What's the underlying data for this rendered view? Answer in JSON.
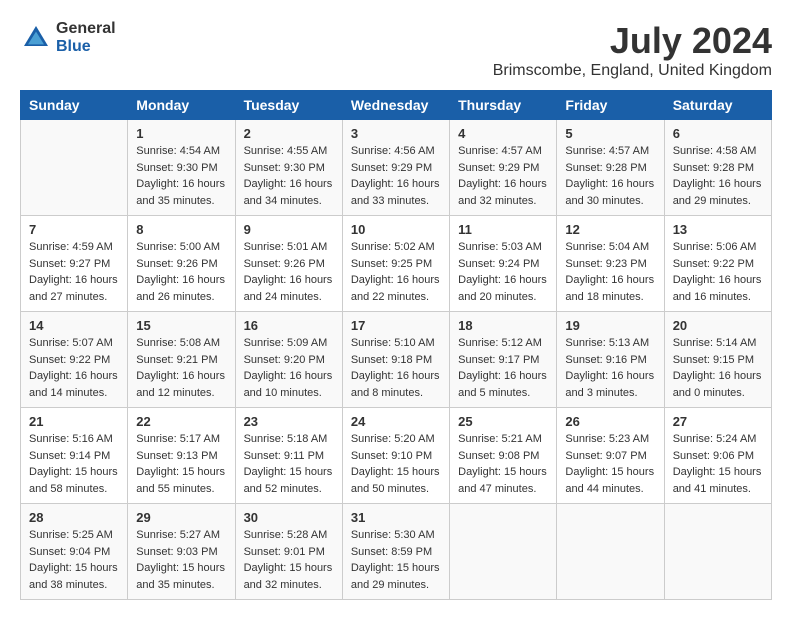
{
  "header": {
    "logo_general": "General",
    "logo_blue": "Blue",
    "title": "July 2024",
    "subtitle": "Brimscombe, England, United Kingdom"
  },
  "days_of_week": [
    "Sunday",
    "Monday",
    "Tuesday",
    "Wednesday",
    "Thursday",
    "Friday",
    "Saturday"
  ],
  "weeks": [
    [
      {
        "day": "",
        "info": ""
      },
      {
        "day": "1",
        "info": "Sunrise: 4:54 AM\nSunset: 9:30 PM\nDaylight: 16 hours\nand 35 minutes."
      },
      {
        "day": "2",
        "info": "Sunrise: 4:55 AM\nSunset: 9:30 PM\nDaylight: 16 hours\nand 34 minutes."
      },
      {
        "day": "3",
        "info": "Sunrise: 4:56 AM\nSunset: 9:29 PM\nDaylight: 16 hours\nand 33 minutes."
      },
      {
        "day": "4",
        "info": "Sunrise: 4:57 AM\nSunset: 9:29 PM\nDaylight: 16 hours\nand 32 minutes."
      },
      {
        "day": "5",
        "info": "Sunrise: 4:57 AM\nSunset: 9:28 PM\nDaylight: 16 hours\nand 30 minutes."
      },
      {
        "day": "6",
        "info": "Sunrise: 4:58 AM\nSunset: 9:28 PM\nDaylight: 16 hours\nand 29 minutes."
      }
    ],
    [
      {
        "day": "7",
        "info": "Sunrise: 4:59 AM\nSunset: 9:27 PM\nDaylight: 16 hours\nand 27 minutes."
      },
      {
        "day": "8",
        "info": "Sunrise: 5:00 AM\nSunset: 9:26 PM\nDaylight: 16 hours\nand 26 minutes."
      },
      {
        "day": "9",
        "info": "Sunrise: 5:01 AM\nSunset: 9:26 PM\nDaylight: 16 hours\nand 24 minutes."
      },
      {
        "day": "10",
        "info": "Sunrise: 5:02 AM\nSunset: 9:25 PM\nDaylight: 16 hours\nand 22 minutes."
      },
      {
        "day": "11",
        "info": "Sunrise: 5:03 AM\nSunset: 9:24 PM\nDaylight: 16 hours\nand 20 minutes."
      },
      {
        "day": "12",
        "info": "Sunrise: 5:04 AM\nSunset: 9:23 PM\nDaylight: 16 hours\nand 18 minutes."
      },
      {
        "day": "13",
        "info": "Sunrise: 5:06 AM\nSunset: 9:22 PM\nDaylight: 16 hours\nand 16 minutes."
      }
    ],
    [
      {
        "day": "14",
        "info": "Sunrise: 5:07 AM\nSunset: 9:22 PM\nDaylight: 16 hours\nand 14 minutes."
      },
      {
        "day": "15",
        "info": "Sunrise: 5:08 AM\nSunset: 9:21 PM\nDaylight: 16 hours\nand 12 minutes."
      },
      {
        "day": "16",
        "info": "Sunrise: 5:09 AM\nSunset: 9:20 PM\nDaylight: 16 hours\nand 10 minutes."
      },
      {
        "day": "17",
        "info": "Sunrise: 5:10 AM\nSunset: 9:18 PM\nDaylight: 16 hours\nand 8 minutes."
      },
      {
        "day": "18",
        "info": "Sunrise: 5:12 AM\nSunset: 9:17 PM\nDaylight: 16 hours\nand 5 minutes."
      },
      {
        "day": "19",
        "info": "Sunrise: 5:13 AM\nSunset: 9:16 PM\nDaylight: 16 hours\nand 3 minutes."
      },
      {
        "day": "20",
        "info": "Sunrise: 5:14 AM\nSunset: 9:15 PM\nDaylight: 16 hours\nand 0 minutes."
      }
    ],
    [
      {
        "day": "21",
        "info": "Sunrise: 5:16 AM\nSunset: 9:14 PM\nDaylight: 15 hours\nand 58 minutes."
      },
      {
        "day": "22",
        "info": "Sunrise: 5:17 AM\nSunset: 9:13 PM\nDaylight: 15 hours\nand 55 minutes."
      },
      {
        "day": "23",
        "info": "Sunrise: 5:18 AM\nSunset: 9:11 PM\nDaylight: 15 hours\nand 52 minutes."
      },
      {
        "day": "24",
        "info": "Sunrise: 5:20 AM\nSunset: 9:10 PM\nDaylight: 15 hours\nand 50 minutes."
      },
      {
        "day": "25",
        "info": "Sunrise: 5:21 AM\nSunset: 9:08 PM\nDaylight: 15 hours\nand 47 minutes."
      },
      {
        "day": "26",
        "info": "Sunrise: 5:23 AM\nSunset: 9:07 PM\nDaylight: 15 hours\nand 44 minutes."
      },
      {
        "day": "27",
        "info": "Sunrise: 5:24 AM\nSunset: 9:06 PM\nDaylight: 15 hours\nand 41 minutes."
      }
    ],
    [
      {
        "day": "28",
        "info": "Sunrise: 5:25 AM\nSunset: 9:04 PM\nDaylight: 15 hours\nand 38 minutes."
      },
      {
        "day": "29",
        "info": "Sunrise: 5:27 AM\nSunset: 9:03 PM\nDaylight: 15 hours\nand 35 minutes."
      },
      {
        "day": "30",
        "info": "Sunrise: 5:28 AM\nSunset: 9:01 PM\nDaylight: 15 hours\nand 32 minutes."
      },
      {
        "day": "31",
        "info": "Sunrise: 5:30 AM\nSunset: 8:59 PM\nDaylight: 15 hours\nand 29 minutes."
      },
      {
        "day": "",
        "info": ""
      },
      {
        "day": "",
        "info": ""
      },
      {
        "day": "",
        "info": ""
      }
    ]
  ]
}
